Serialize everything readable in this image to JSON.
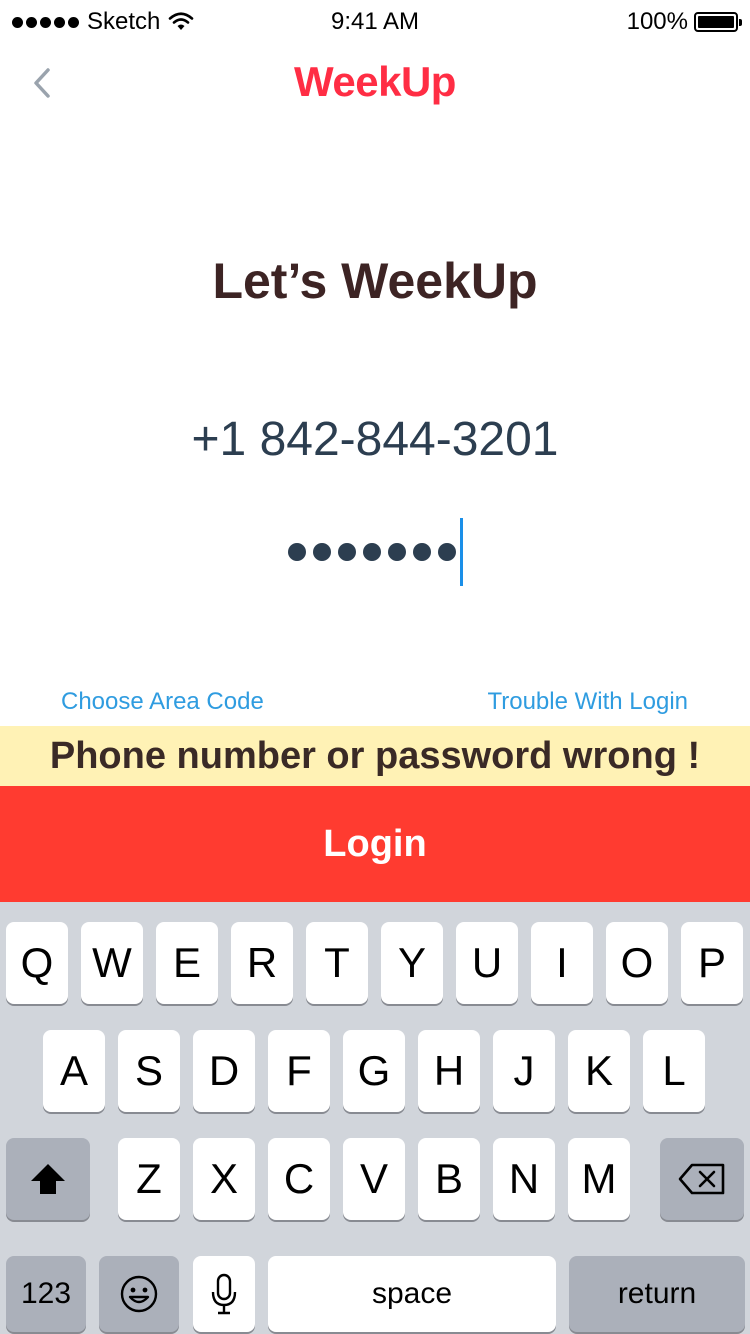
{
  "status_bar": {
    "carrier": "Sketch",
    "time": "9:41 AM",
    "battery": "100%",
    "battery_level": 1.0
  },
  "nav": {
    "back_icon": "chevron-left-icon",
    "brand": "WeekUp"
  },
  "main": {
    "headline": "Let’s WeekUp",
    "phone_value": "+1 842-844-3201",
    "password_masked_count": 7,
    "choose_area_code": "Choose Area Code",
    "trouble_login": "Trouble With Login"
  },
  "error_message": "Phone number or password wrong !",
  "login_button": "Login",
  "keyboard": {
    "row1": [
      "Q",
      "W",
      "E",
      "R",
      "T",
      "Y",
      "U",
      "I",
      "O",
      "P"
    ],
    "row2": [
      "A",
      "S",
      "D",
      "F",
      "G",
      "H",
      "J",
      "K",
      "L"
    ],
    "row3": [
      "Z",
      "X",
      "C",
      "V",
      "B",
      "N",
      "M"
    ],
    "shift_icon": "shift-arrow-icon",
    "delete_icon": "backspace-icon",
    "numbers_label": "123",
    "emoji_icon": "emoji-icon",
    "mic_icon": "microphone-icon",
    "space_label": "space",
    "return_label": "return"
  },
  "colors": {
    "brand": "#ff2d44",
    "login_bg": "#ff3b30",
    "error_bg": "#fff2b5",
    "link": "#2f9ce0",
    "caret": "#1a8fe8"
  }
}
